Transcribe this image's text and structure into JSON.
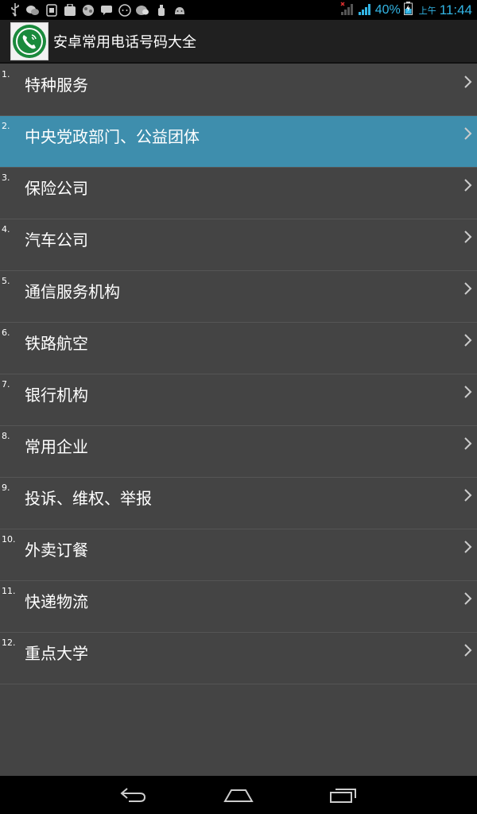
{
  "status_bar": {
    "notification_icons": [
      "usb-icon",
      "wechat-icon",
      "sim-icon",
      "app-store-icon",
      "game-icon",
      "message-icon",
      "chat-icon",
      "wechat-alt-icon",
      "cleaner-icon",
      "android-icon"
    ],
    "battery_percent": "40%",
    "ampm": "上午",
    "time": "11:44"
  },
  "app": {
    "title": "安卓常用电话号码大全"
  },
  "list": {
    "items": [
      {
        "number": "1.",
        "label": "特种服务"
      },
      {
        "number": "2.",
        "label": "中央党政部门、公益团体"
      },
      {
        "number": "3.",
        "label": "保险公司"
      },
      {
        "number": "4.",
        "label": "汽车公司"
      },
      {
        "number": "5.",
        "label": "通信服务机构"
      },
      {
        "number": "6.",
        "label": "铁路航空"
      },
      {
        "number": "7.",
        "label": "银行机构"
      },
      {
        "number": "8.",
        "label": "常用企业"
      },
      {
        "number": "9.",
        "label": "投诉、维权、举报"
      },
      {
        "number": "10.",
        "label": "外卖订餐"
      },
      {
        "number": "11.",
        "label": "快递物流"
      },
      {
        "number": "12.",
        "label": "重点大学"
      }
    ],
    "selected_index": 1
  },
  "colors": {
    "background": "#444444",
    "selected": "#3e8ead",
    "accent": "#33b5e5"
  }
}
